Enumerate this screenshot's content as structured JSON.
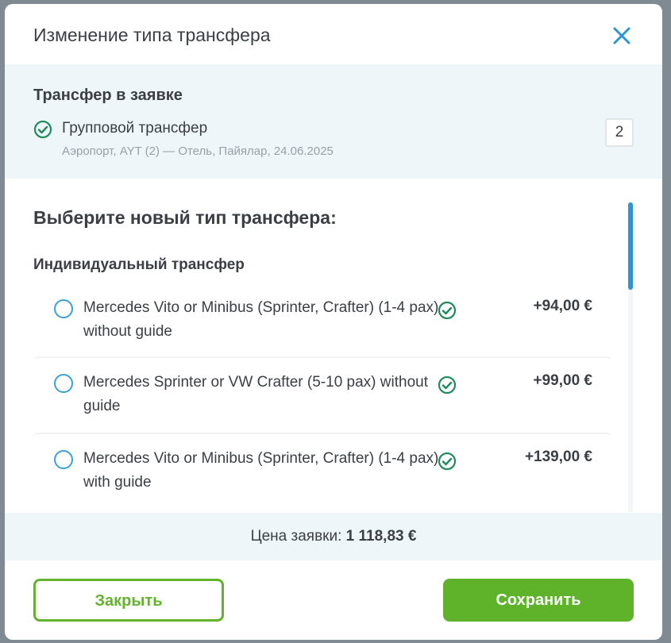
{
  "modal": {
    "title": "Изменение типа трансфера",
    "current": {
      "heading": "Трансфер в заявке",
      "name": "Групповой трансфер",
      "route": "Аэропорт, AYT (2) — Отель, Пайялар, 24.06.2025",
      "quantity": "2"
    },
    "choose": {
      "heading": "Выберите новый тип трансфера:",
      "group_heading": "Индивидуальный трансфер",
      "options": [
        {
          "label": "Mercedes Vito or Minibus (Sprinter, Crafter) (1-4 pax) without guide",
          "price": "+94,00 €"
        },
        {
          "label": "Mercedes Sprinter or VW Crafter (5-10 pax) without guide",
          "price": "+99,00 €"
        },
        {
          "label": "Mercedes Vito or Minibus (Sprinter, Crafter) (1-4 pax) with guide",
          "price": "+139,00 €"
        }
      ]
    },
    "price_bar": {
      "label": "Цена заявки:",
      "value": "1 118,83 €"
    },
    "buttons": {
      "close": "Закрыть",
      "save": "Сохранить"
    }
  },
  "colors": {
    "accent_blue": "#2e94d8",
    "check_green": "#1f8a5b",
    "button_green": "#5eb32a",
    "light_panel": "#eef6fa"
  },
  "icons": {
    "close": "close-icon",
    "check": "check-circle-icon",
    "radio": "radio-unchecked-icon"
  }
}
